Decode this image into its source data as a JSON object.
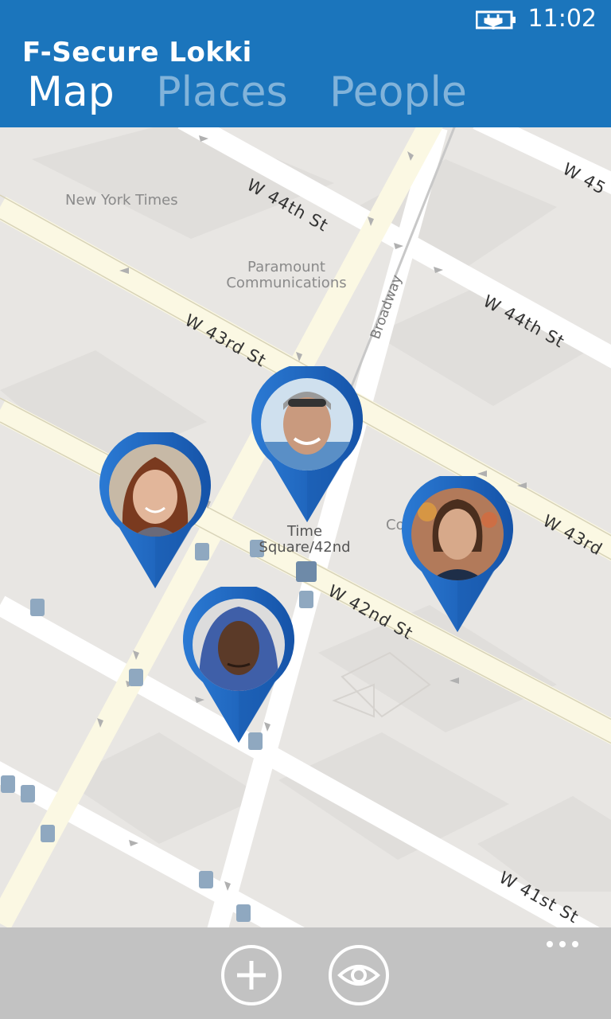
{
  "status": {
    "time": "11:02"
  },
  "app": {
    "title": "F-Secure Lokki"
  },
  "pivot": [
    {
      "label": "Map",
      "active": true
    },
    {
      "label": "Places",
      "active": false
    },
    {
      "label": "People",
      "active": false
    }
  ],
  "map": {
    "poi_labels": {
      "nyt": "New York Times",
      "paramount": "Paramount Communications",
      "times_square": "Time Square/42nd",
      "co": "Co"
    },
    "streets": {
      "w44_top": "W 44th St",
      "w45": "W 45",
      "w44_right": "W 44th St",
      "w43_left": "W 43rd St",
      "w43_right": "W 43rd",
      "w42": "W 42nd St",
      "w41": "W 41st St",
      "broadway": "Broadway"
    },
    "people": [
      {
        "name": "Man with sunglasses",
        "icon": "person-avatar"
      },
      {
        "name": "Woman with red hair",
        "icon": "person-avatar"
      },
      {
        "name": "Young woman",
        "icon": "person-avatar"
      },
      {
        "name": "Man in hoodie",
        "icon": "person-avatar"
      }
    ]
  },
  "appbar": {
    "add_icon": "add-icon",
    "view_icon": "eye-icon",
    "more_icon": "more-icon"
  },
  "colors": {
    "header": "#1b75bc",
    "pin": "#1f6fc0",
    "road_major": "#fbf8e3",
    "road_minor": "#ffffff",
    "appbar": "#c2c2c2"
  }
}
